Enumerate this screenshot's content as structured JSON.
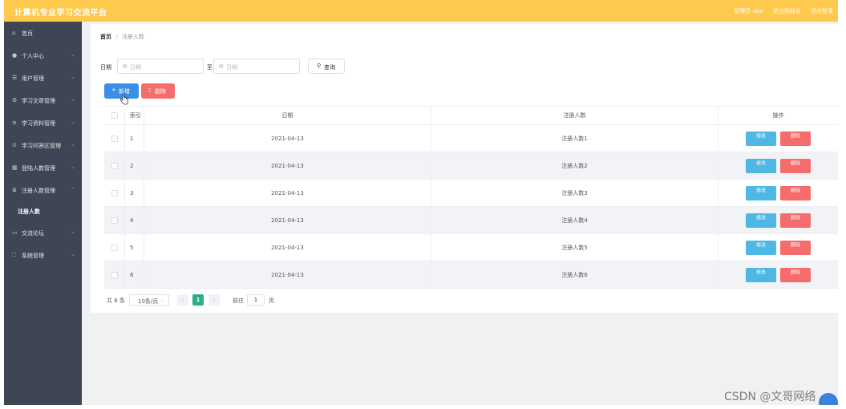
{
  "header": {
    "title": "计算机专业学习交流平台",
    "user_label": "管理员 abo",
    "back_to_front": "退出到前台",
    "logout": "退出登录",
    "bar_color": "#ffc94d"
  },
  "sidebar": {
    "items": [
      {
        "label": "首页",
        "icon": "home-icon"
      },
      {
        "label": "个人中心",
        "icon": "user-icon"
      },
      {
        "label": "用户管理",
        "icon": "list-icon"
      },
      {
        "label": "学习文章管理",
        "icon": "gear-icon"
      },
      {
        "label": "学习资料管理",
        "icon": "doc-icon"
      },
      {
        "label": "学习问答区管理",
        "icon": "question-icon"
      },
      {
        "label": "登陆人数管理",
        "icon": "grid-icon"
      },
      {
        "label": "注册人数管理",
        "icon": "stack-icon"
      },
      {
        "label": "交流论坛",
        "icon": "chat-icon"
      },
      {
        "label": "系统管理",
        "icon": "system-icon"
      }
    ],
    "submenu_item": "注册人数"
  },
  "breadcrumb": {
    "home": "首页",
    "separator": "/",
    "current": "注册人数"
  },
  "search": {
    "date_label": "日期",
    "start_placeholder": "日期",
    "to_label": "至",
    "end_placeholder": "日期",
    "query_label": "查询"
  },
  "actions": {
    "add_label": "新增",
    "batch_delete_label": "删除"
  },
  "table": {
    "headers": {
      "index": "索引",
      "date": "日期",
      "name": "注册人数",
      "ops": "操作"
    },
    "rows": [
      {
        "index": "1",
        "date": "2021-04-13",
        "name": "注册人数1",
        "edit": "修改",
        "delete": "删除"
      },
      {
        "index": "2",
        "date": "2021-04-13",
        "name": "注册人数2",
        "edit": "修改",
        "delete": "删除"
      },
      {
        "index": "3",
        "date": "2021-04-13",
        "name": "注册人数3",
        "edit": "修改",
        "delete": "删除"
      },
      {
        "index": "4",
        "date": "2021-04-13",
        "name": "注册人数4",
        "edit": "修改",
        "delete": "删除"
      },
      {
        "index": "5",
        "date": "2021-04-13",
        "name": "注册人数5",
        "edit": "修改",
        "delete": "删除"
      },
      {
        "index": "6",
        "date": "2021-04-13",
        "name": "注册人数6",
        "edit": "修改",
        "delete": "删除"
      }
    ]
  },
  "pagination": {
    "total_text": "共 6 条",
    "page_size": "10条/页",
    "current_page": "1",
    "goto_label": "前往",
    "goto_value": "1",
    "goto_unit": "页"
  },
  "watermark": "CSDN @文哥网络",
  "colors": {
    "accent_green": "#29b089",
    "primary_blue": "#3a8ee6",
    "danger_red": "#f56c6c",
    "edit_blue": "#4fb7e3",
    "sidebar_bg": "#3e4554"
  }
}
